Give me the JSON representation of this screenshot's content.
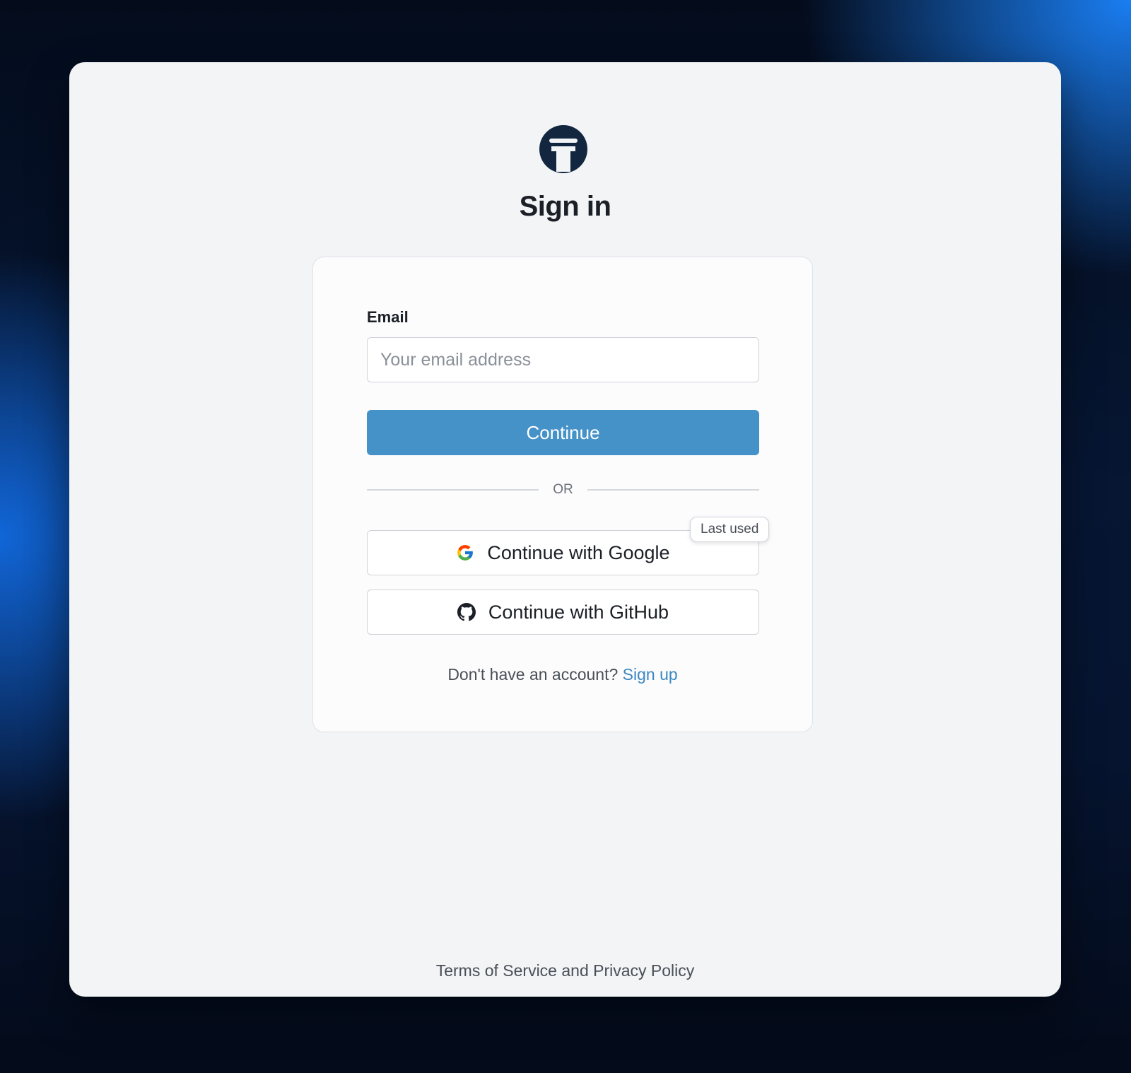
{
  "page": {
    "title": "Sign in",
    "logo_icon": "pillar-logo-icon",
    "logo_color": "#12263f"
  },
  "form": {
    "email_label": "Email",
    "email_placeholder": "Your email address",
    "email_value": "",
    "continue_label": "Continue",
    "continue_color": "#4592c9",
    "divider_text": "OR"
  },
  "oauth": {
    "google_label": "Continue with Google",
    "google_icon": "google-icon",
    "github_label": "Continue with GitHub",
    "github_icon": "github-icon",
    "last_used_badge": "Last used"
  },
  "signup": {
    "prompt": "Don't have an account?",
    "link_label": "Sign up",
    "link_color": "#3a88c2"
  },
  "footer": {
    "legal_link": "Terms of Service and Privacy Policy"
  }
}
